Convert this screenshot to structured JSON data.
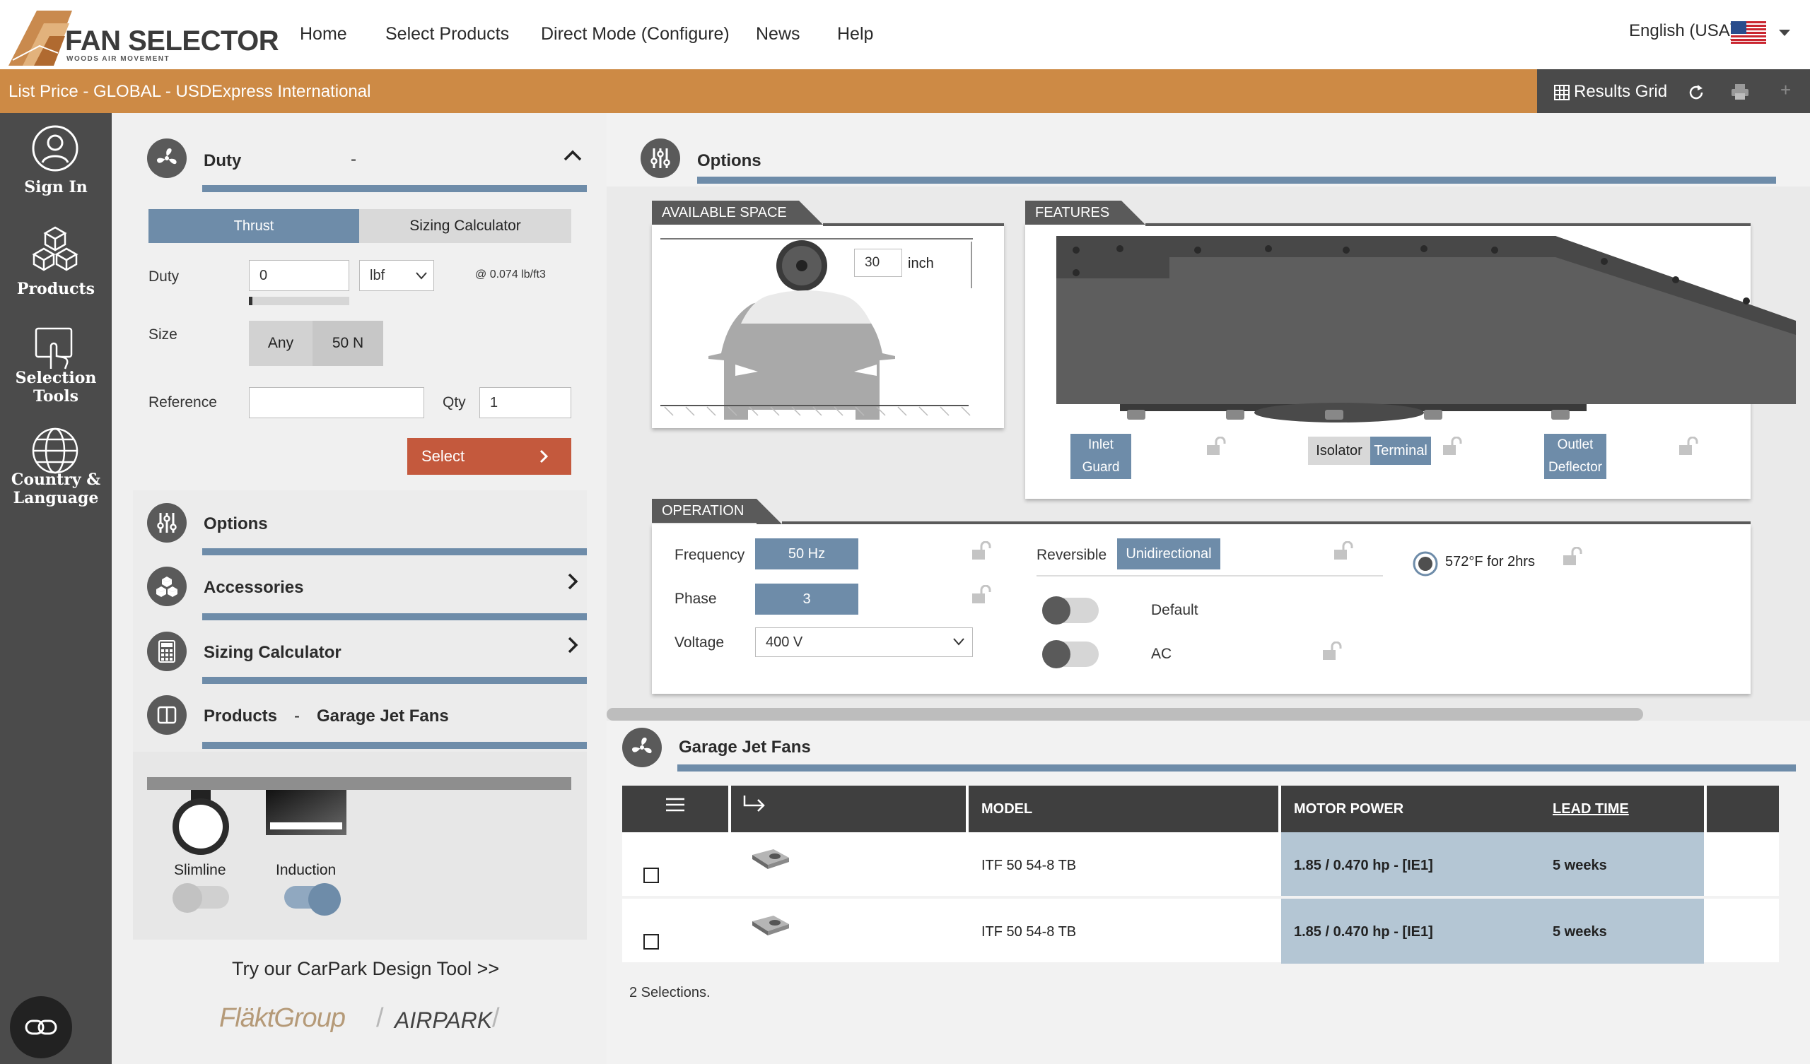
{
  "header": {
    "logo_title": "FAN SELECTOR",
    "logo_sub": "WOODS AIR MOVEMENT",
    "nav": [
      "Home",
      "Select Products",
      "Direct Mode (Configure)",
      "News",
      "Help"
    ],
    "language": "English (USA)"
  },
  "orange_bar": {
    "price_list": "List Price - GLOBAL - USD",
    "region": "Express International",
    "results_grid": "Results Grid"
  },
  "sidebar": {
    "sign_in": "Sign In",
    "products": "Products",
    "selection_tools": [
      "Selection",
      "Tools"
    ],
    "country_language": [
      "Country &",
      "Language"
    ]
  },
  "duty": {
    "title": "Duty",
    "dash": "-",
    "tabs": [
      "Thrust",
      "Sizing Calculator"
    ],
    "duty_label": "Duty",
    "duty_value": "0",
    "unit": "lbf",
    "density": "@ 0.074 lb/ft3",
    "size_label": "Size",
    "size_options": [
      "Any",
      "50 N"
    ],
    "reference_label": "Reference",
    "reference_value": "",
    "qty_label": "Qty",
    "qty_value": "1",
    "select_label": "Select"
  },
  "left_sections": {
    "options": "Options",
    "accessories": "Accessories",
    "sizing_calculator": "Sizing Calculator",
    "products": "Products",
    "products_dash": "-",
    "products_value": "Garage Jet Fans"
  },
  "product_types": {
    "slimline": "Slimline",
    "induction": "Induction",
    "slimline_on": false,
    "induction_on": true
  },
  "promo": {
    "carpark": "Try our CarPark Design Tool >>",
    "brand1": "FläktGroup",
    "separator": "/",
    "brand2": "AIRPARK"
  },
  "options_panel": {
    "title": "Options",
    "available_space": {
      "tag": "AVAILABLE SPACE",
      "value": "30",
      "unit": "inch"
    },
    "features": {
      "tag": "FEATURES",
      "inlet_guard": [
        "Inlet",
        "Guard"
      ],
      "isolator": "Isolator",
      "terminal": "Terminal",
      "outlet_deflector": [
        "Outlet",
        "Deflector"
      ]
    },
    "operation": {
      "tag": "OPERATION",
      "frequency_label": "Frequency",
      "frequency_value": "50 Hz",
      "phase_label": "Phase",
      "phase_value": "3",
      "voltage_label": "Voltage",
      "voltage_value": "400 V",
      "reversible_label": "Reversible",
      "reversible_value": "Unidirectional",
      "default_label": "Default",
      "ac_label": "AC",
      "temp_label": "572°F for 2hrs"
    }
  },
  "results": {
    "title": "Garage Jet Fans",
    "columns": [
      "MODEL",
      "MOTOR POWER",
      "LEAD TIME"
    ],
    "rows": [
      {
        "model": "ITF 50 54-8 TB",
        "motor_power": "1.85 / 0.470 hp - [IE1]",
        "lead_time": "5 weeks"
      },
      {
        "model": "ITF 50 54-8 TB",
        "motor_power": "1.85 / 0.470 hp - [IE1]",
        "lead_time": "5 weeks"
      }
    ],
    "summary": "2 Selections."
  },
  "colors": {
    "accent_orange": "#cd8a45",
    "select_red": "#c4593d",
    "steel_blue": "#6e8ca9",
    "sidebar_dark": "#4b4b4b"
  }
}
